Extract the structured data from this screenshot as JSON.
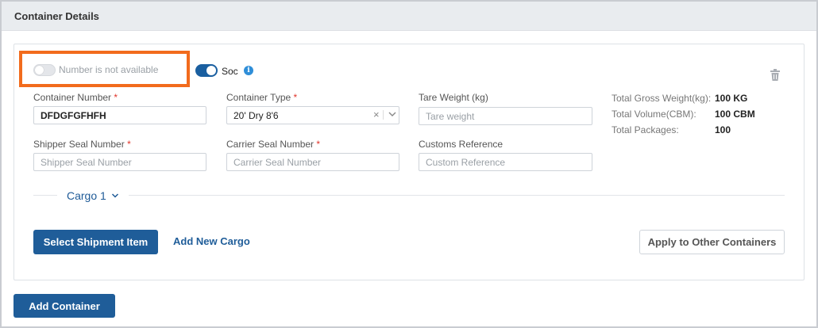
{
  "section": {
    "title": "Container Details"
  },
  "number_toggle": {
    "label": "Number is not available",
    "state": "off"
  },
  "soc_toggle": {
    "label": "Soc",
    "state": "on"
  },
  "fields": {
    "container_number": {
      "label": "Container Number",
      "required_mark": "*",
      "value": "DFDGFGFHFH"
    },
    "container_type": {
      "label": "Container Type",
      "required_mark": "*",
      "value": "20' Dry 8'6"
    },
    "tare_weight": {
      "label": "Tare Weight (kg)",
      "placeholder": "Tare weight"
    },
    "shipper_seal": {
      "label": "Shipper Seal Number",
      "required_mark": "*",
      "placeholder": "Shipper Seal Number"
    },
    "carrier_seal": {
      "label": "Carrier Seal Number",
      "required_mark": "*",
      "placeholder": "Carrier Seal Number"
    },
    "customs_ref": {
      "label": "Customs Reference",
      "placeholder": "Custom Reference"
    }
  },
  "summary": [
    {
      "label": "Total Gross Weight(kg):",
      "value": "100 KG"
    },
    {
      "label": "Total Volume(CBM):",
      "value": "100 CBM"
    },
    {
      "label": "Total Packages:",
      "value": "100"
    }
  ],
  "cargo_tab": {
    "label": "Cargo 1"
  },
  "actions": {
    "select_shipment": "Select Shipment Item",
    "add_cargo": "Add New Cargo",
    "apply_others": "Apply to Other Containers",
    "add_container": "Add Container"
  },
  "icons": {
    "info": "info-icon",
    "trash": "trash-icon",
    "clear": "close-icon",
    "caret": "chevron-down-icon"
  },
  "colors": {
    "accent": "#1f5d99",
    "highlight": "#f26b1d",
    "required": "#e0342a",
    "info": "#2f8ed8"
  }
}
